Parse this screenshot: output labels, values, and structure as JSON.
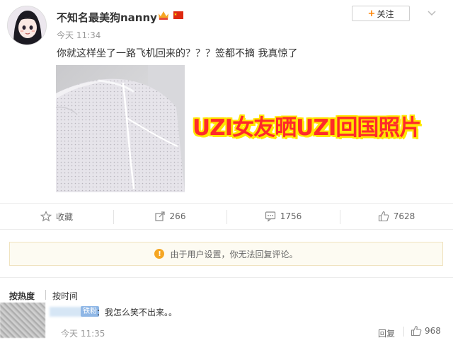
{
  "post": {
    "username": "不知名最美狗nanny",
    "time": "今天 11:34",
    "text": "你就这样坐了一路飞机回来的？？？签都不摘 我真惊了",
    "follow_label": "关注",
    "image_caption": "UZI女友晒UZI回国照片"
  },
  "actions": {
    "favorite_label": "收藏",
    "repost_count": "266",
    "comment_count": "1756",
    "like_count": "7628"
  },
  "notice": {
    "text": "由于用户设置，你无法回复评论。"
  },
  "sort": {
    "hot": "按热度",
    "time": "按时间"
  },
  "comment": {
    "tag": "铁粉",
    "text": "：我怎么笑不出来。。",
    "time": "今天 11:35",
    "reply_label": "回复",
    "like_count": "968"
  },
  "colors": {
    "accent": "#ff8200",
    "caption_red": "#ff2a2a",
    "caption_outline": "#ffe600",
    "warning": "#f5a623"
  }
}
